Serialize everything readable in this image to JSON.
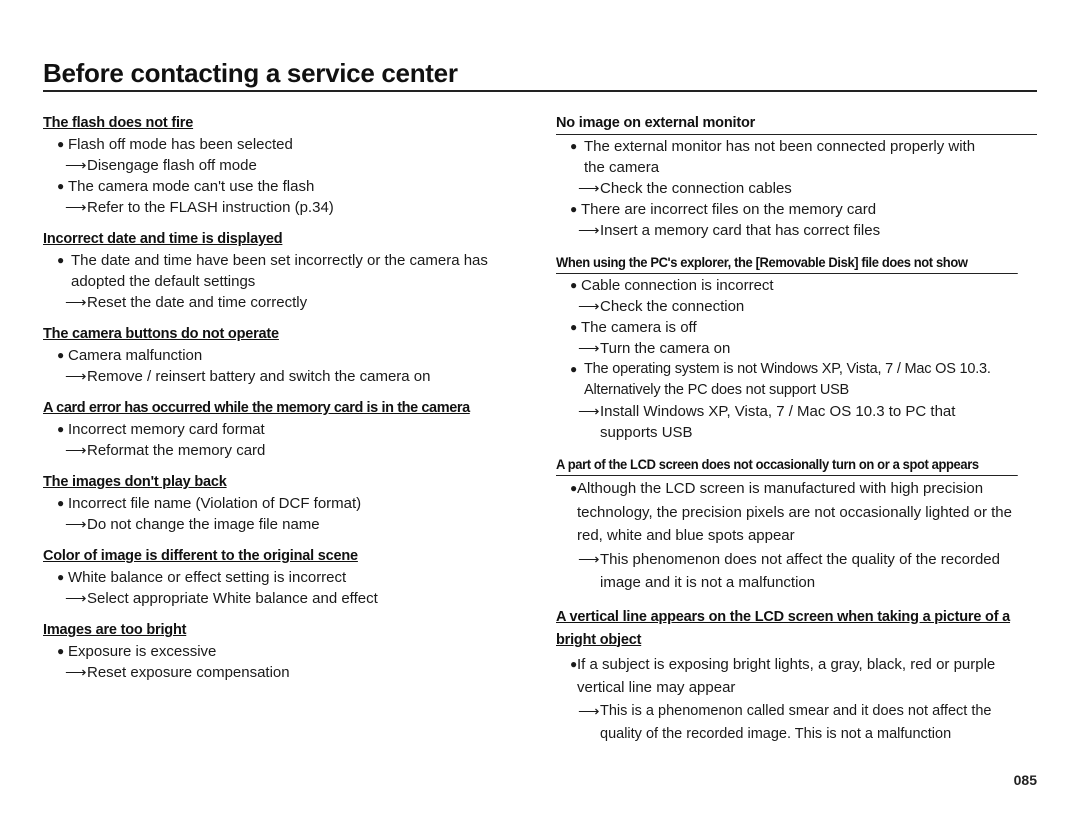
{
  "page": {
    "title": "Before contacting a service center",
    "page_number": "085"
  },
  "icons": {
    "bullet": "●",
    "arrow": "⟶"
  },
  "left_column": [
    {
      "heading": "The flash does not fire",
      "entries": [
        {
          "cause": "Flash off mode has been selected",
          "remedy": "Disengage flash off mode"
        },
        {
          "cause": "The camera mode can't use the flash",
          "remedy": "Refer to the FLASH instruction (p.34)"
        }
      ]
    },
    {
      "heading": "Incorrect date and time is displayed",
      "entries": [
        {
          "cause": "The date and time have been set incorrectly or the camera has adopted the default settings",
          "remedy": "Reset the date and time correctly"
        }
      ]
    },
    {
      "heading": "The camera buttons do not operate",
      "entries": [
        {
          "cause": "Camera malfunction",
          "remedy": "Remove / reinsert battery and switch the camera on"
        }
      ]
    },
    {
      "heading": "A card error has occurred while the memory card is in the camera",
      "entries": [
        {
          "cause": "Incorrect memory card format",
          "remedy": "Reformat the memory card"
        }
      ]
    },
    {
      "heading": "The images don't play back",
      "entries": [
        {
          "cause": "Incorrect file name (Violation of DCF format)",
          "remedy": "Do not change the image file name"
        }
      ]
    },
    {
      "heading": "Color of image is different to the original scene",
      "entries": [
        {
          "cause": "White balance or effect setting is incorrect",
          "remedy": "Select appropriate White balance and effect"
        }
      ]
    },
    {
      "heading": "Images are too bright",
      "entries": [
        {
          "cause": "Exposure is excessive",
          "remedy": "Reset exposure compensation"
        }
      ]
    }
  ],
  "right_column": [
    {
      "heading": "No image on external monitor",
      "entries": [
        {
          "cause": "The external monitor has not been connected properly with the camera",
          "remedy": "Check the connection cables"
        },
        {
          "cause": "There are incorrect files on the memory card",
          "remedy": "Insert a memory card that has correct files"
        }
      ]
    },
    {
      "heading": "When using the PC's explorer, the [Removable Disk] file does not show",
      "entries": [
        {
          "cause": "Cable connection is incorrect",
          "remedy": "Check the connection"
        },
        {
          "cause": "The camera is off",
          "remedy": "Turn the camera on"
        },
        {
          "cause": "The operating system is not Windows XP, Vista, 7 / Mac OS 10.3. Alternatively the PC does not support USB",
          "remedy": "Install Windows XP, Vista, 7 / Mac OS 10.3 to PC that supports USB"
        }
      ]
    },
    {
      "heading": "A part of the LCD screen does not occasionally turn on or a spot appears",
      "entries": [
        {
          "cause": "Although the LCD screen is manufactured with high precision technology, the precision pixels are not occasionally lighted or the red, white and blue spots appear",
          "remedy": "This phenomenon does not affect the quality of the recorded image and it is not a malfunction"
        }
      ]
    },
    {
      "heading": "A vertical line appears on the LCD screen when taking a picture of a bright object",
      "entries": [
        {
          "cause": "If a subject is exposing bright lights, a gray, black, red or purple vertical line may appear",
          "remedy": "This is a phenomenon called smear and it does not affect the quality of the recorded image. This is not a malfunction"
        }
      ]
    }
  ]
}
